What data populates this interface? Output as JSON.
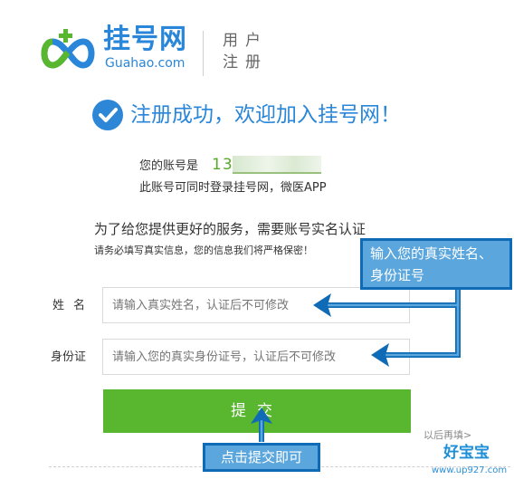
{
  "header": {
    "logo_name": "挂号网",
    "logo_domain": "Guahao.com",
    "title_line1": "用户",
    "title_line2": "注册"
  },
  "success": {
    "title": "注册成功，欢迎加入挂号网！",
    "account_label": "您的账号是",
    "account_value": "13",
    "account_note": "此账号可同时登录挂号网，微医APP"
  },
  "verify": {
    "heading": "为了给您提供更好的服务，需要账号实名认证",
    "subtext": "请务必填写真实信息，您的信息我们将严格保密！"
  },
  "form": {
    "name_label": "姓名",
    "name_placeholder": "请输入真实姓名，认证后不可修改",
    "id_label": "身份证",
    "id_placeholder": "请输入您的真实身份证号，认证后不可修改",
    "submit_label": "提交",
    "later_link": "以后再填>"
  },
  "annotations": {
    "fill_hint_line1": "输入您的真实姓名、",
    "fill_hint_line2": "身份证号",
    "submit_hint": "点击提交即可"
  },
  "watermark": {
    "name": "好宝宝",
    "url": "www.up927.com"
  },
  "colors": {
    "brand_blue": "#2a86d8",
    "brand_green": "#58b62f",
    "annotation_blue": "#0f6bb5",
    "annotation_fill": "#5ba6dc"
  }
}
